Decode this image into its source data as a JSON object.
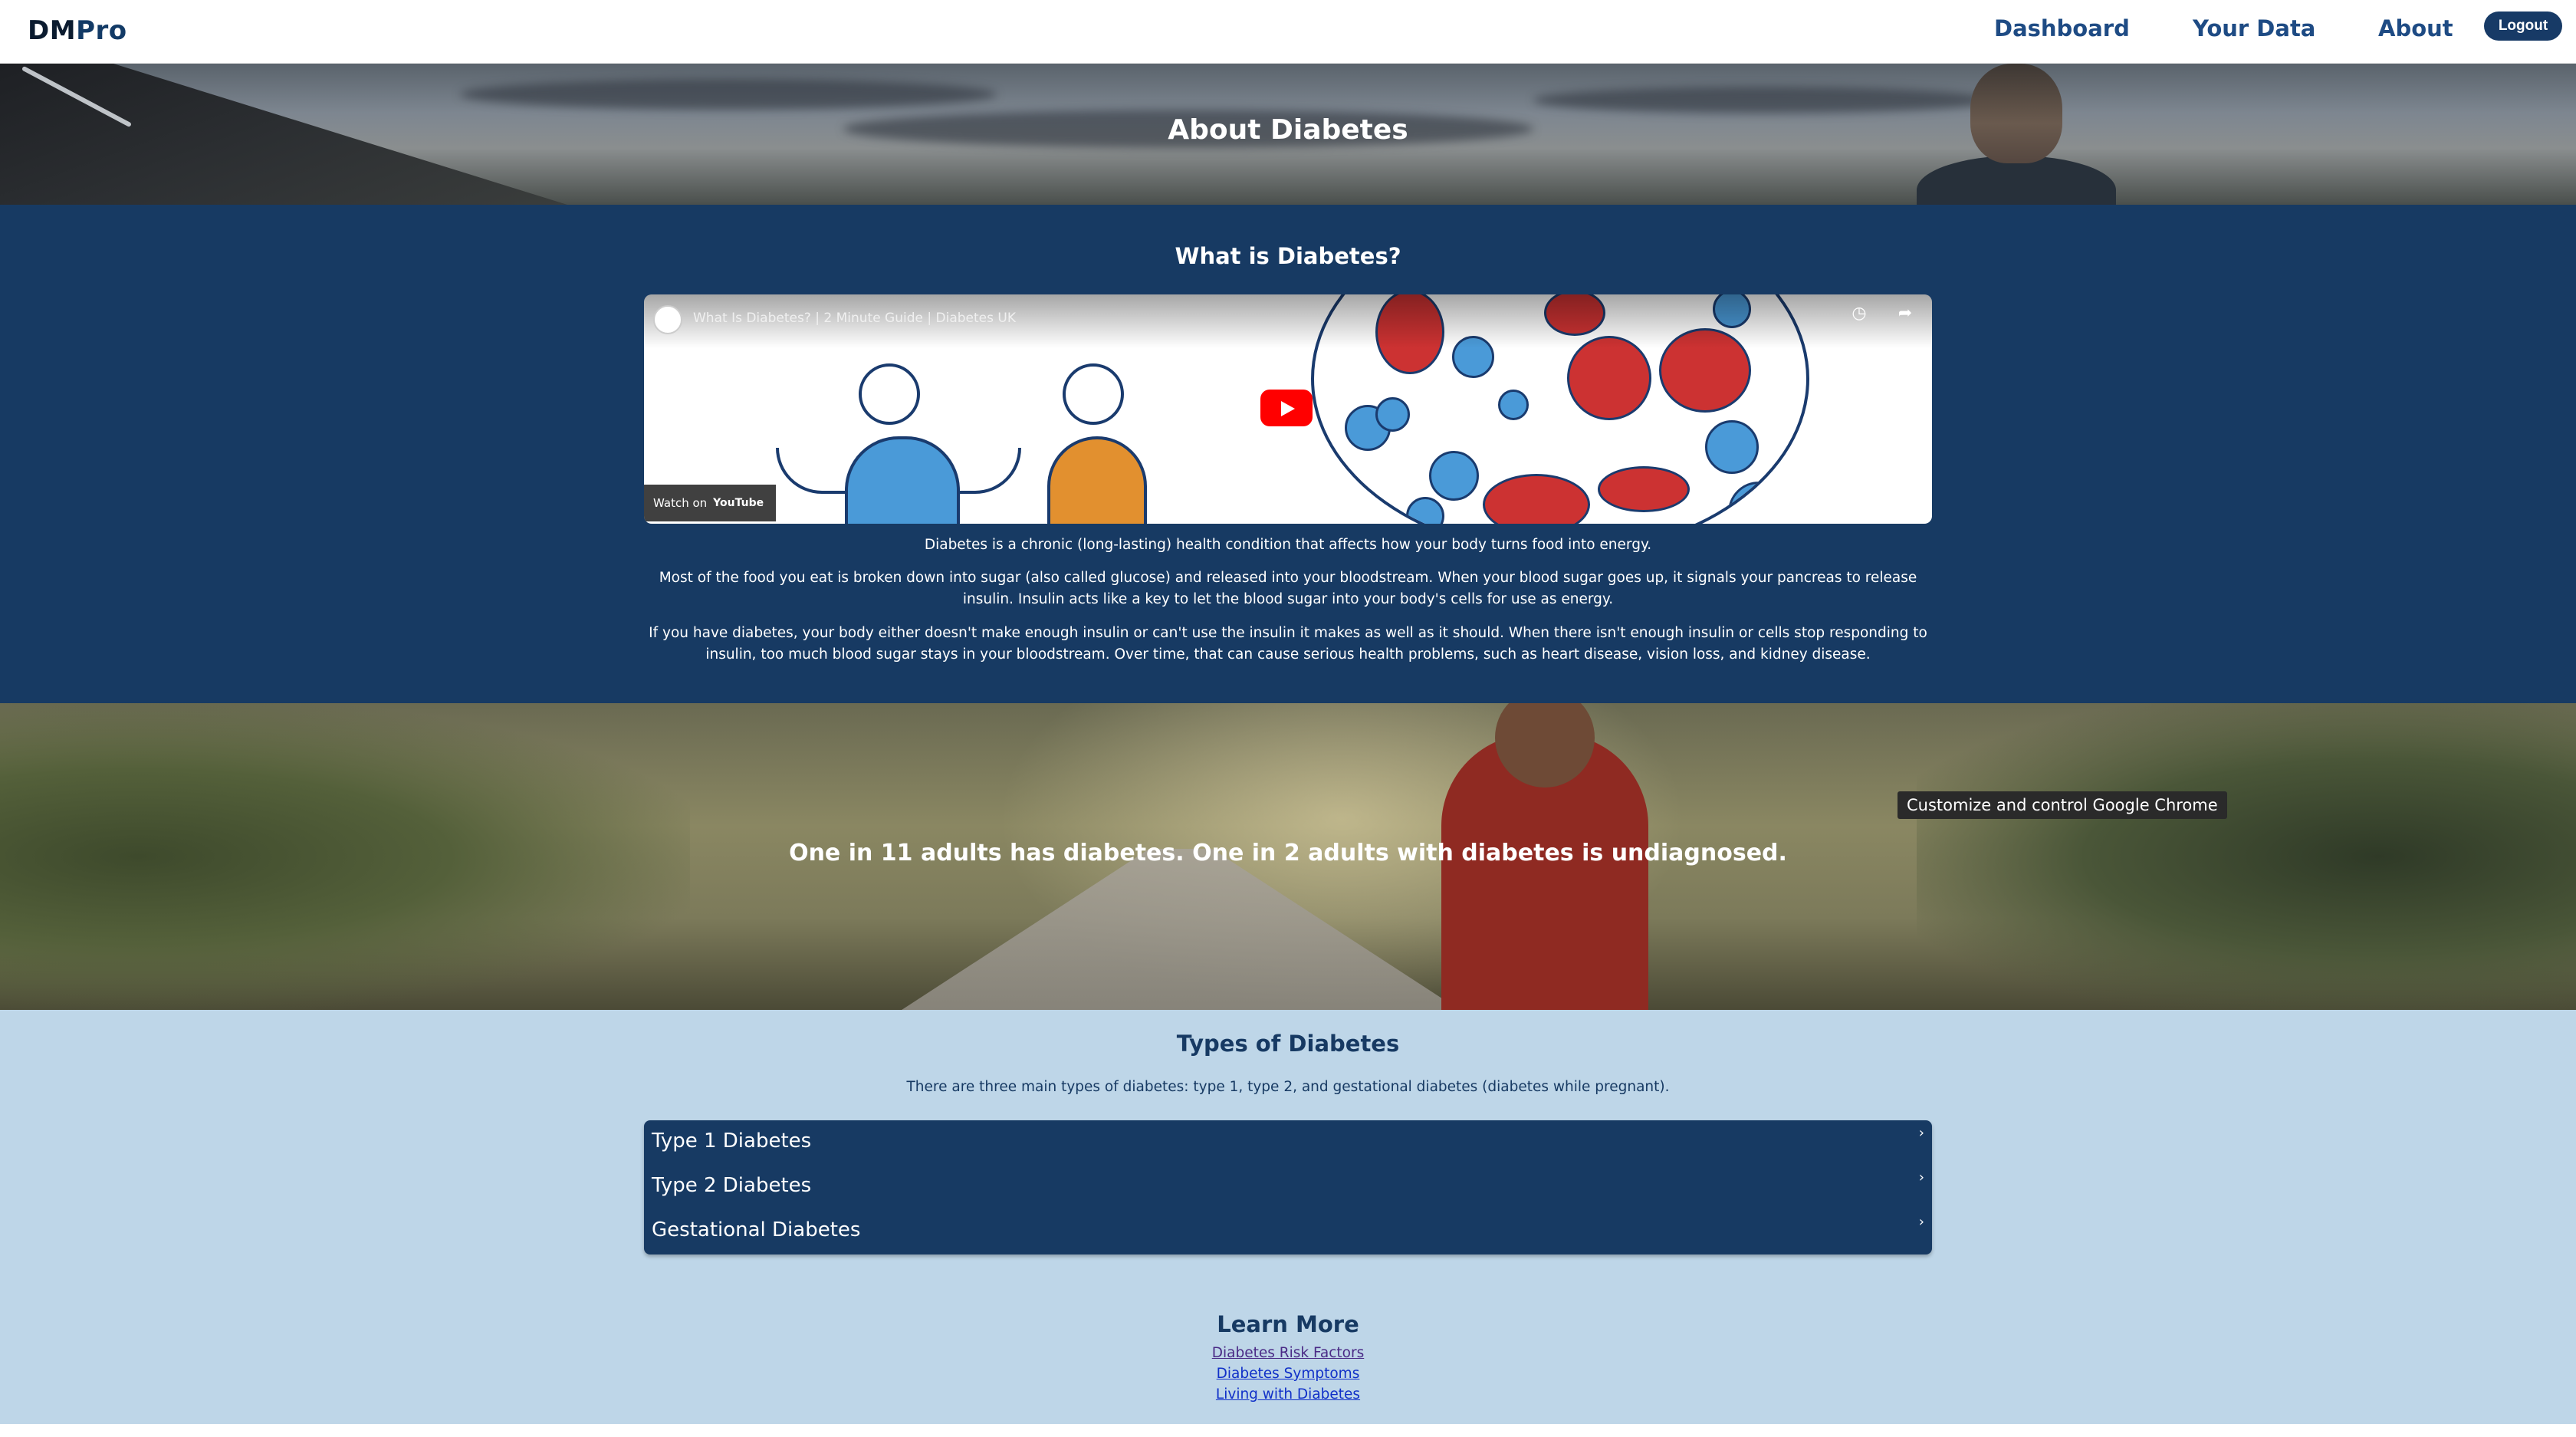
{
  "navbar": {
    "brand_dm": "DM",
    "brand_pro": "Pro",
    "links": [
      "Dashboard",
      "Your Data",
      "About"
    ],
    "logout_label": "Logout"
  },
  "hero": {
    "title": "About Diabetes"
  },
  "what_is": {
    "title": "What is Diabetes?",
    "video": {
      "title": "What Is Diabetes? | 2 Minute Guide | Diabetes UK",
      "watch_on": "Watch on",
      "youtube": "YouTube"
    },
    "paragraphs": [
      "Diabetes is a chronic (long-lasting) health condition that affects how your body turns food into energy.",
      "Most of the food you eat is broken down into sugar (also called glucose) and released into your bloodstream. When your blood sugar goes up, it signals your pancreas to release insulin. Insulin acts like a key to let the blood sugar into your body's cells for use as energy.",
      "If you have diabetes, your body either doesn't make enough insulin or can't use the insulin it makes as well as it should. When there isn't enough insulin or cells stop responding to insulin, too much blood sugar stays in your bloodstream. Over time, that can cause serious health problems, such as heart disease, vision loss, and kidney disease."
    ]
  },
  "stat_banner": {
    "text": "One in 11 adults has diabetes. One in 2 adults with diabetes is undiagnosed.",
    "tooltip": "Customize and control Google Chrome"
  },
  "types": {
    "title": "Types of Diabetes",
    "intro": "There are three main types of diabetes: type 1, type 2, and gestational diabetes (diabetes while pregnant).",
    "items": [
      "Type 1 Diabetes",
      "Type 2 Diabetes",
      "Gestational Diabetes"
    ],
    "chevron": "›"
  },
  "learn_more": {
    "title": "Learn More",
    "links": [
      "Diabetes Risk Factors",
      "Diabetes Symptoms",
      "Living with Diabetes"
    ]
  },
  "colors": {
    "navy": "#173a63",
    "light_blue": "#bed6e8",
    "nav_link": "#1e4b84"
  }
}
